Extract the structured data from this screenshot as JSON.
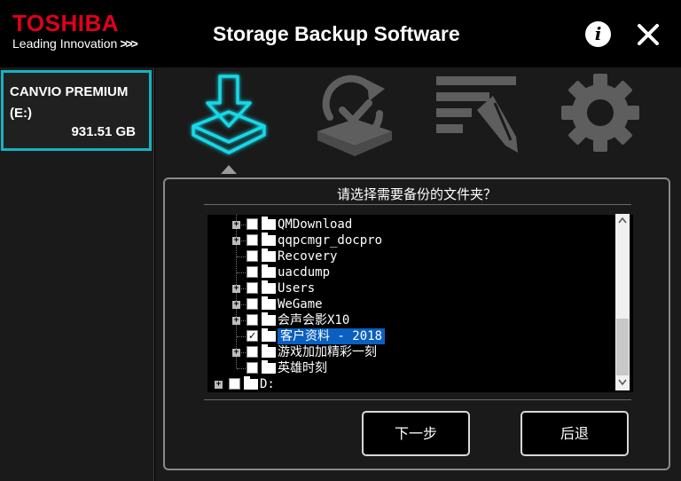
{
  "header": {
    "brand": "TOSHIBA",
    "tagline": "Leading Innovation",
    "tagline_arrows": ">>>",
    "title": "Storage Backup Software",
    "info_label": "i"
  },
  "sidebar": {
    "drive": {
      "name_line1": "CANVIO PREMIUM",
      "name_line2": "(E:)",
      "size": "931.51 GB"
    }
  },
  "nav": {
    "items": [
      {
        "icon": "backup-download-icon",
        "active": true
      },
      {
        "icon": "restore-sync-icon",
        "active": false
      },
      {
        "icon": "edit-list-icon",
        "active": false
      },
      {
        "icon": "gear-icon",
        "active": false
      }
    ]
  },
  "panel": {
    "title": "请选择需要备份的文件夹？",
    "tree": [
      {
        "label": "QMDownload",
        "expandable": true,
        "checked": false,
        "selected": false
      },
      {
        "label": "qqpcmgr_docpro",
        "expandable": true,
        "checked": false,
        "selected": false
      },
      {
        "label": "Recovery",
        "expandable": false,
        "checked": false,
        "selected": false
      },
      {
        "label": "uacdump",
        "expandable": false,
        "checked": false,
        "selected": false
      },
      {
        "label": "Users",
        "expandable": true,
        "checked": false,
        "selected": false
      },
      {
        "label": "WeGame",
        "expandable": true,
        "checked": false,
        "selected": false
      },
      {
        "label": "会声会影X10",
        "expandable": true,
        "checked": false,
        "selected": false
      },
      {
        "label": "客户资料 - 2018",
        "expandable": false,
        "checked": true,
        "selected": true
      },
      {
        "label": "游戏加加精彩一刻",
        "expandable": true,
        "checked": false,
        "selected": false
      },
      {
        "label": "英雄时刻",
        "expandable": false,
        "checked": false,
        "selected": false
      },
      {
        "label": "D:",
        "expandable": true,
        "checked": false,
        "selected": false,
        "root": true
      }
    ],
    "next_button": "下一步",
    "back_button": "后退"
  },
  "colors": {
    "brand_red": "#e0001c",
    "accent_cyan": "#14b4c3",
    "selection_blue": "#0a5fc0"
  }
}
